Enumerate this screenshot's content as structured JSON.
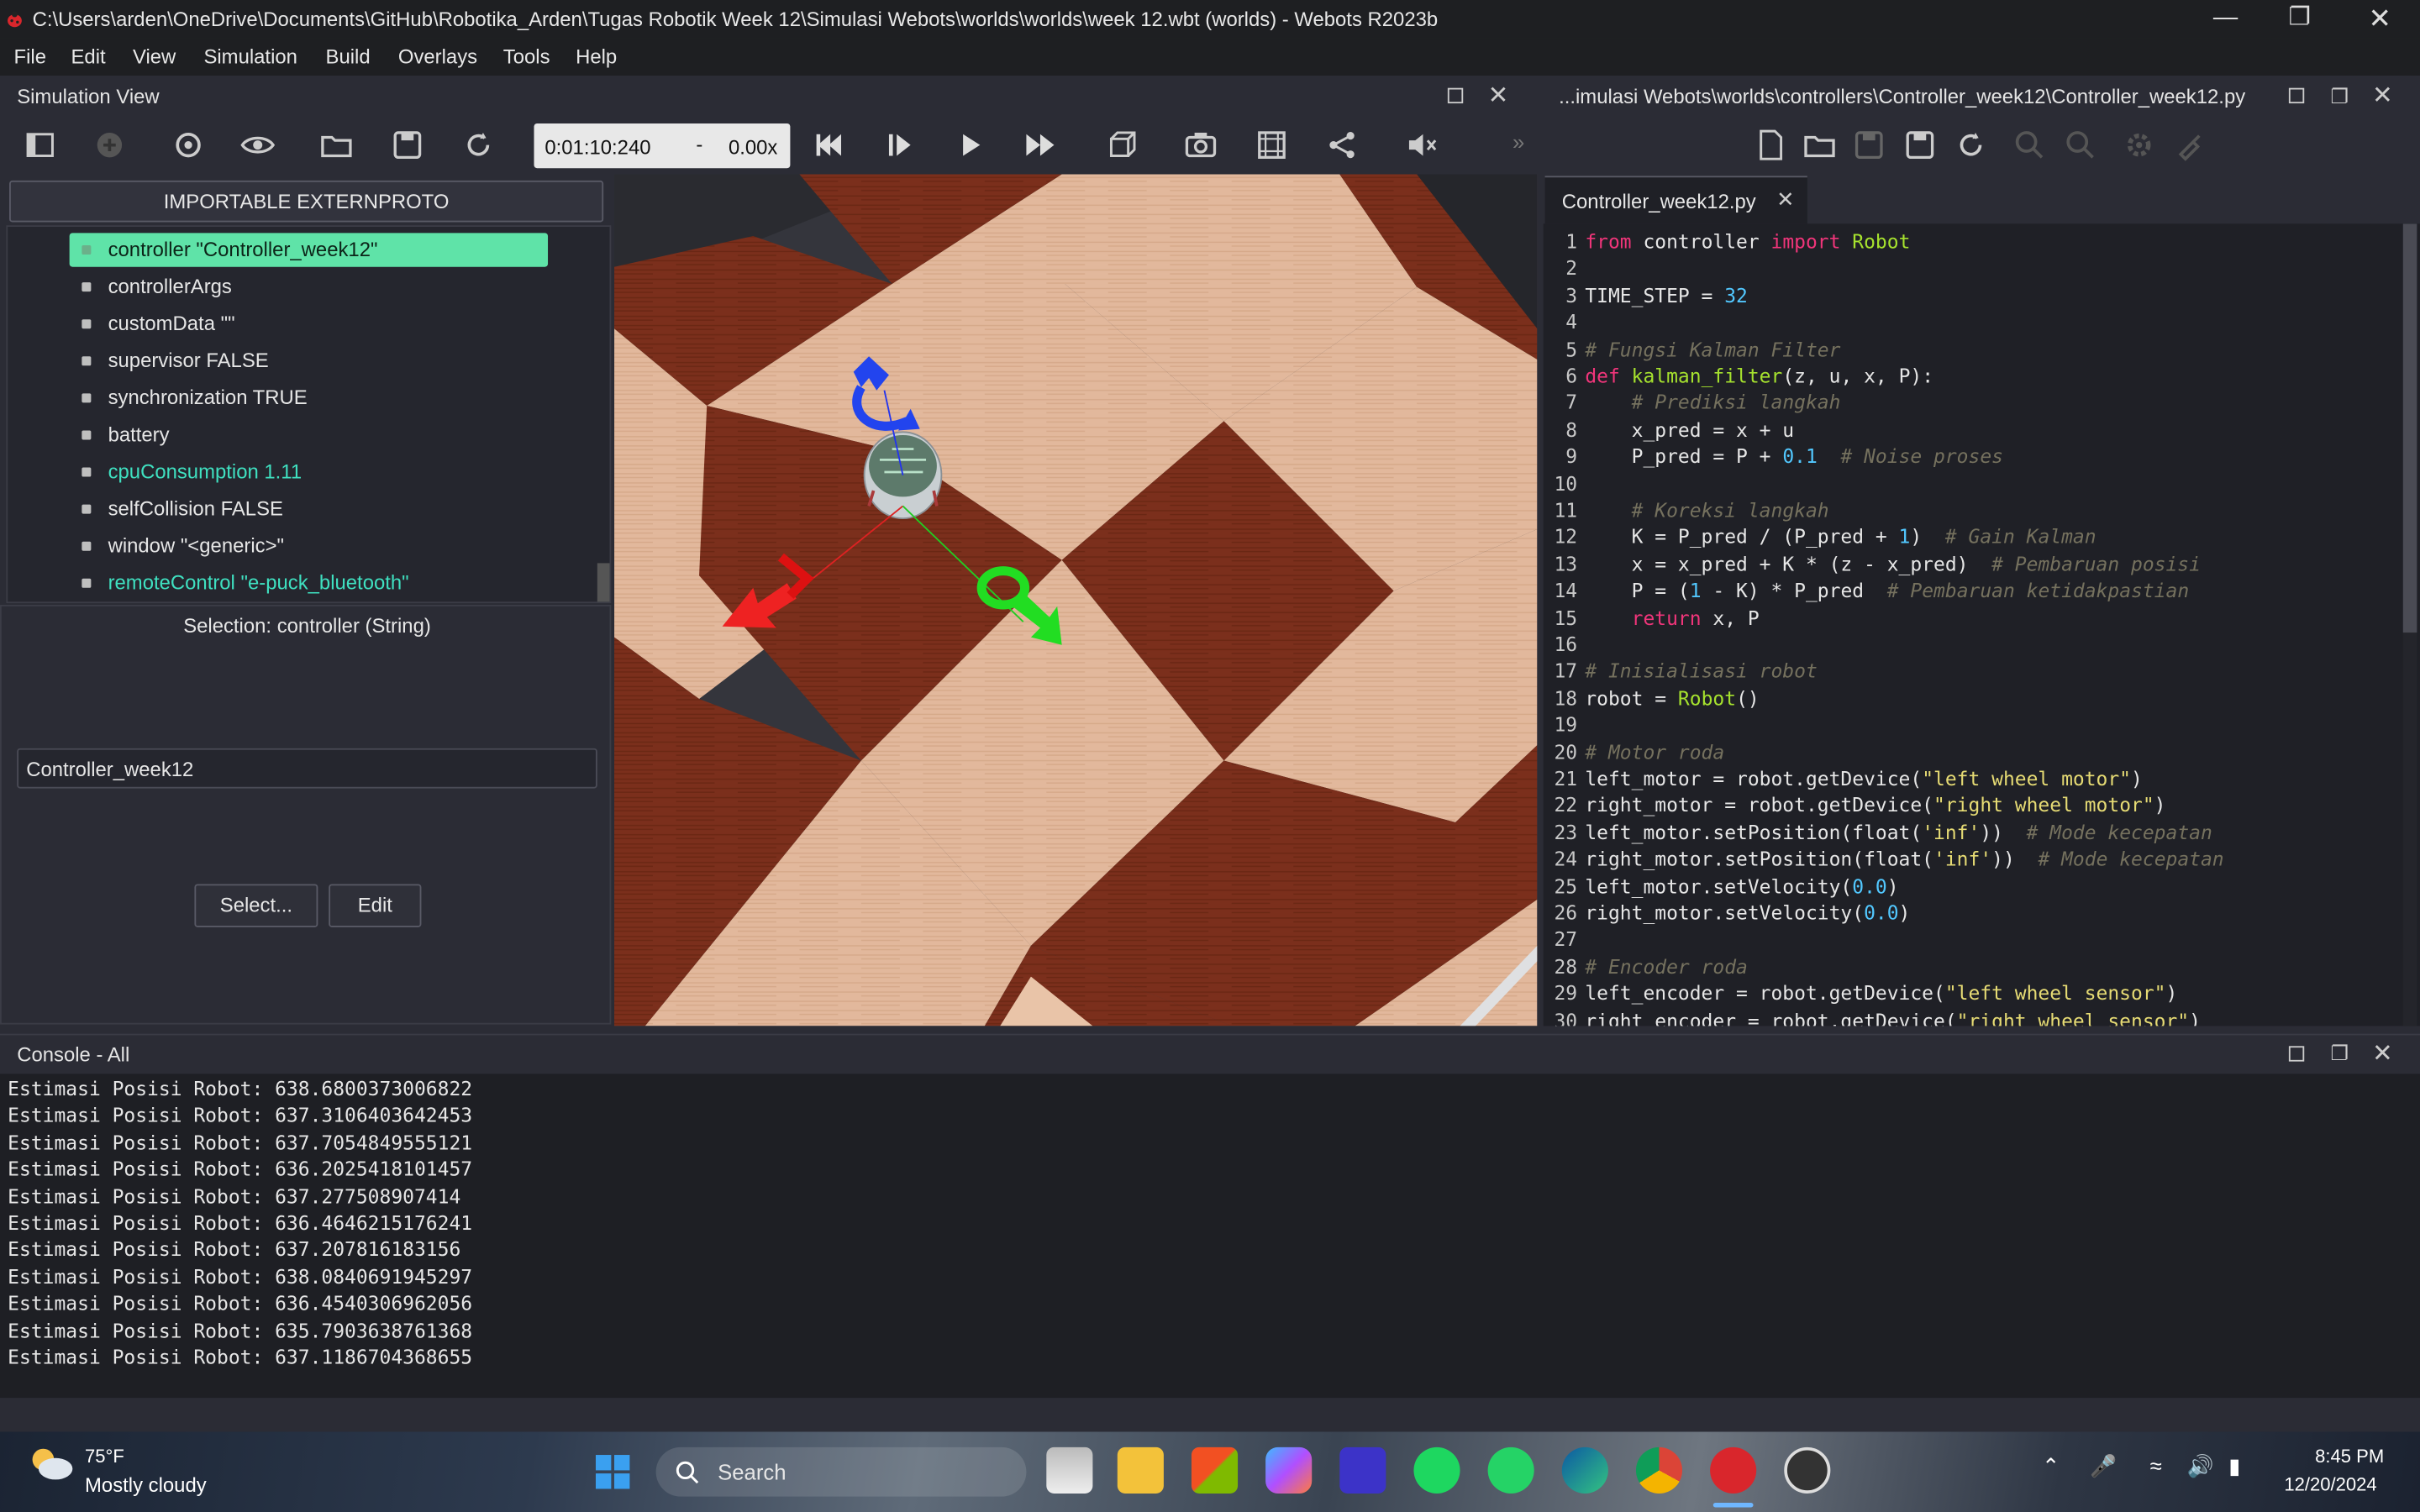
{
  "window": {
    "title": "C:\\Users\\arden\\OneDrive\\Documents\\GitHub\\Robotika_Arden\\Tugas Robotik Week 12\\Simulasi Webots\\worlds\\worlds\\week 12.wbt (worlds) - Webots R2023b"
  },
  "menu": [
    "File",
    "Edit",
    "View",
    "Simulation",
    "Build",
    "Overlays",
    "Tools",
    "Help"
  ],
  "simulation_view": {
    "title": "Simulation View",
    "time": "0:01:10:240",
    "time_sep": "-",
    "speed": "0.00x"
  },
  "scene_tree": {
    "header": "IMPORTABLE EXTERNPROTO",
    "items": [
      {
        "label": "controller \"Controller_week12\"",
        "state": "selected"
      },
      {
        "label": "controllerArgs",
        "state": "normal"
      },
      {
        "label": "customData \"\"",
        "state": "normal"
      },
      {
        "label": "supervisor FALSE",
        "state": "normal"
      },
      {
        "label": "synchronization TRUE",
        "state": "normal"
      },
      {
        "label": "battery",
        "state": "normal"
      },
      {
        "label": "cpuConsumption 1.11",
        "state": "modified"
      },
      {
        "label": "selfCollision FALSE",
        "state": "normal"
      },
      {
        "label": "window \"<generic>\"",
        "state": "normal"
      },
      {
        "label": "remoteControl \"e-puck_bluetooth\"",
        "state": "modified"
      }
    ]
  },
  "field_editor": {
    "selection": "Selection: controller (String)",
    "value": "Controller_week12",
    "select_label": "Select...",
    "edit_label": "Edit"
  },
  "text_editor": {
    "path": "...imulasi Webots\\worlds\\controllers\\Controller_week12\\Controller_week12.py",
    "tab": "Controller_week12.py",
    "lines": [
      [
        [
          "from",
          "kw"
        ],
        [
          " controller ",
          ""
        ],
        [
          "import",
          "kw"
        ],
        [
          " ",
          ""
        ],
        [
          "Robot",
          "cls"
        ]
      ],
      [],
      [
        [
          "TIME_STEP = ",
          ""
        ],
        [
          "32",
          "num"
        ]
      ],
      [],
      [
        [
          "# Fungsi Kalman Filter",
          "cm"
        ]
      ],
      [
        [
          "def",
          "kw"
        ],
        [
          " ",
          ""
        ],
        [
          "kalman_filter",
          "cls"
        ],
        [
          "(z, u, x, P):",
          ""
        ]
      ],
      [
        [
          "    ",
          ""
        ],
        [
          "# Prediksi langkah",
          "cm"
        ]
      ],
      [
        [
          "    x_pred = x + u",
          ""
        ]
      ],
      [
        [
          "    P_pred = P + ",
          ""
        ],
        [
          "0.1",
          "num"
        ],
        [
          "  ",
          ""
        ],
        [
          "# Noise proses",
          "cm"
        ]
      ],
      [],
      [
        [
          "    ",
          ""
        ],
        [
          "# Koreksi langkah",
          "cm"
        ]
      ],
      [
        [
          "    K = P_pred / (P_pred + ",
          ""
        ],
        [
          "1",
          "num"
        ],
        [
          ")  ",
          ""
        ],
        [
          "# Gain Kalman",
          "cm"
        ]
      ],
      [
        [
          "    x = x_pred + K * (z - x_pred)  ",
          ""
        ],
        [
          "# Pembaruan posisi",
          "cm"
        ]
      ],
      [
        [
          "    P = (",
          ""
        ],
        [
          "1",
          "num"
        ],
        [
          " - K) * P_pred  ",
          ""
        ],
        [
          "# Pembaruan ketidakpastian",
          "cm"
        ]
      ],
      [
        [
          "    ",
          ""
        ],
        [
          "return",
          "kw"
        ],
        [
          " x, P",
          ""
        ]
      ],
      [],
      [
        [
          "# Inisialisasi robot",
          "cm"
        ]
      ],
      [
        [
          "robot = ",
          ""
        ],
        [
          "Robot",
          "cls"
        ],
        [
          "()",
          ""
        ]
      ],
      [],
      [
        [
          "# Motor roda",
          "cm"
        ]
      ],
      [
        [
          "left_motor = robot.getDevice(",
          ""
        ],
        [
          "\"left wheel motor\"",
          "str"
        ],
        [
          ")",
          ""
        ]
      ],
      [
        [
          "right_motor = robot.getDevice(",
          ""
        ],
        [
          "\"right wheel motor\"",
          "str"
        ],
        [
          ")",
          ""
        ]
      ],
      [
        [
          "left_motor.setPosition(float(",
          ""
        ],
        [
          "'inf'",
          "str"
        ],
        [
          "))  ",
          ""
        ],
        [
          "# Mode kecepatan",
          "cm"
        ]
      ],
      [
        [
          "right_motor.setPosition(float(",
          ""
        ],
        [
          "'inf'",
          "str"
        ],
        [
          "))  ",
          ""
        ],
        [
          "# Mode kecepatan",
          "cm"
        ]
      ],
      [
        [
          "left_motor.setVelocity(",
          ""
        ],
        [
          "0.0",
          "num"
        ],
        [
          ")",
          ""
        ]
      ],
      [
        [
          "right_motor.setVelocity(",
          ""
        ],
        [
          "0.0",
          "num"
        ],
        [
          ")",
          ""
        ]
      ],
      [],
      [
        [
          "# Encoder roda",
          "cm"
        ]
      ],
      [
        [
          "left_encoder = robot.getDevice(",
          ""
        ],
        [
          "\"left wheel sensor\"",
          "str"
        ],
        [
          ")",
          ""
        ]
      ],
      [
        [
          "right_encoder = robot.getDevice(",
          ""
        ],
        [
          "\"right wheel sensor\"",
          "str"
        ],
        [
          ")",
          ""
        ]
      ]
    ]
  },
  "console": {
    "title": "Console - All",
    "lines": [
      "Estimasi Posisi Robot: 638.6800373006822",
      "Estimasi Posisi Robot: 637.3106403642453",
      "Estimasi Posisi Robot: 637.7054849555121",
      "Estimasi Posisi Robot: 636.2025418101457",
      "Estimasi Posisi Robot: 637.277508907414",
      "Estimasi Posisi Robot: 636.4646215176241",
      "Estimasi Posisi Robot: 637.207816183156",
      "Estimasi Posisi Robot: 638.0840691945297",
      "Estimasi Posisi Robot: 636.4540306962056",
      "Estimasi Posisi Robot: 635.7903638761368",
      "Estimasi Posisi Robot: 637.1186704368655"
    ]
  },
  "taskbar": {
    "temperature": "75°F",
    "weather": "Mostly cloudy",
    "search": "Search",
    "time": "8:45 PM",
    "date": "12/20/2024"
  },
  "colors": {
    "selection": "#5fe3a8",
    "modified_field": "#3fe0c0",
    "keyword": "#f0357a",
    "class_name": "#a6e22e",
    "number": "#52c8ff",
    "string": "#e6db74",
    "comment": "#75715e"
  }
}
